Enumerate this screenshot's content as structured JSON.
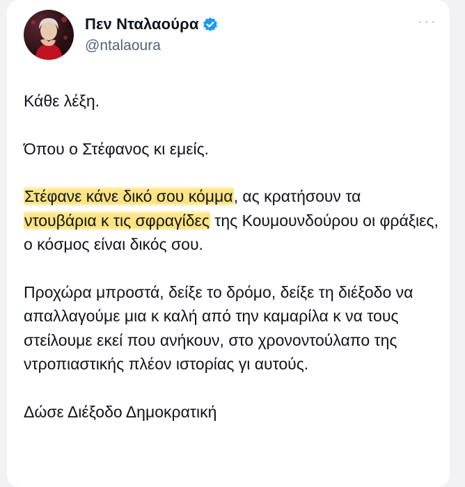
{
  "author": {
    "display_name": "Πεν Νταλαούρα",
    "handle": "@ntalaoura",
    "verified_icon": "verified-badge-icon",
    "verified_color": "#1d9bf0"
  },
  "menu": {
    "more_label": "···"
  },
  "tweet": {
    "p1": "Κάθε λέξη.",
    "p2": "Όπου ο Στέφανος κι εμείς.",
    "p3_hl1": "Στέφανε κάνε δικό σου κόμμα",
    "p3_t1": ", ας κρατήσουν τα",
    "p3_hl2": "ντουβάρια κ τις σφραγίδες",
    "p3_t2": " της Κουμουνδούρου οι φράξιες, ο κόσμος είναι δικός σου.",
    "p4": "Προχώρα μπροστά, δείξε το δρόμο, δείξε τη διέξοδο να απαλλαγούμε μια κ καλή από την καμαρίλα κ να τους στείλουμε εκεί που ανήκουν, στο χρονοντούλαπο της ντροπιαστικής πλέον ιστορίας γι αυτούς.",
    "p5": "Δώσε Διέξοδο Δημοκρατική",
    "highlight_color": "#ffdc5a"
  }
}
